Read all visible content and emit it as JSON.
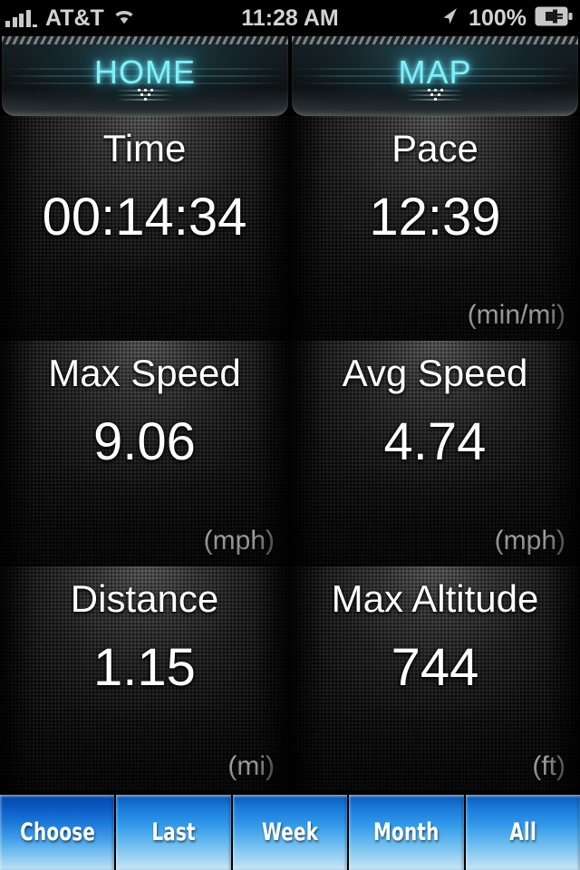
{
  "status_bar": {
    "carrier": "AT&T",
    "time": "11:28 AM",
    "battery_percent": "100%",
    "icons": {
      "signal": "signal-bars-icon",
      "wifi": "wifi-icon",
      "location": "location-arrow-icon",
      "battery": "battery-charging-icon"
    }
  },
  "tabs": [
    {
      "label": "HOME",
      "name": "tab-home",
      "selected": true
    },
    {
      "label": "MAP",
      "name": "tab-map",
      "selected": false
    }
  ],
  "stats": [
    {
      "title": "Time",
      "value": "00:14:34",
      "unit": ""
    },
    {
      "title": "Pace",
      "value": "12:39",
      "unit": "(min/mi)"
    },
    {
      "title": "Max Speed",
      "value": "9.06",
      "unit": "(mph)"
    },
    {
      "title": "Avg Speed",
      "value": "4.74",
      "unit": "(mph)"
    },
    {
      "title": "Distance",
      "value": "1.15",
      "unit": "(mi)"
    },
    {
      "title": "Max Altitude",
      "value": "744",
      "unit": "(ft)"
    }
  ],
  "buttons": [
    {
      "label": "Choose",
      "name": "button-choose"
    },
    {
      "label": "Last",
      "name": "button-last"
    },
    {
      "label": "Week",
      "name": "button-week"
    },
    {
      "label": "Month",
      "name": "button-month"
    },
    {
      "label": "All",
      "name": "button-all"
    }
  ],
  "colors": {
    "tab_accent": "#82eef8",
    "button_blue_top": "#0b55b5",
    "button_blue_bottom": "#c9e6f7",
    "status_text": "#d3d3d3",
    "stat_text": "#ffffff"
  }
}
